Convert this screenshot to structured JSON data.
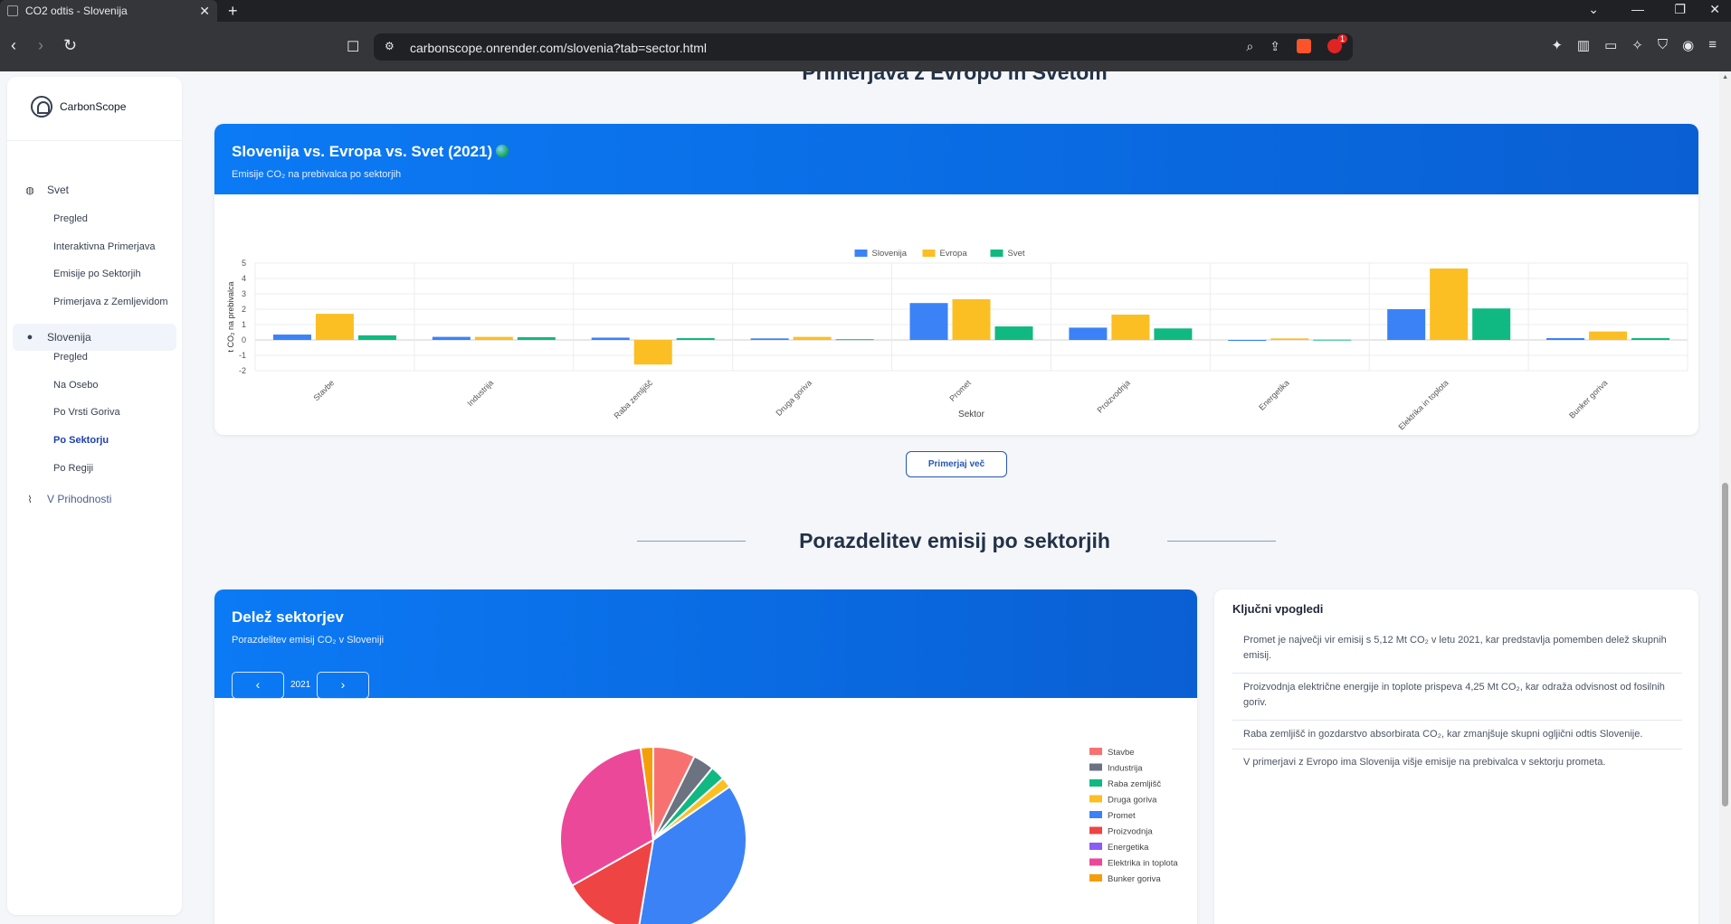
{
  "browser": {
    "tab_title": "CO2 odtis - Slovenija",
    "url": "carbonscope.onrender.com/slovenia?tab=sector.html",
    "notification_count": "1"
  },
  "sidebar": {
    "brand": "CarbonScope",
    "sections": [
      {
        "label": "Svet",
        "icon": "globe-icon",
        "items": [
          "Pregled",
          "Interaktivna Primerjava",
          "Emisije po Sektorjih",
          "Primerjava z Zemljevidom"
        ]
      },
      {
        "label": "Slovenija",
        "icon": "map-pin-icon",
        "items": [
          "Pregled",
          "Na Osebo",
          "Po Vrsti Goriva",
          "Po Sektorju",
          "Po Regiji"
        ]
      },
      {
        "label": "V Prihodnosti",
        "icon": "trend-chart-icon",
        "items": []
      }
    ],
    "current_item": "Po Sektorju"
  },
  "comparison": {
    "heading": "Primerjava z Evropo in Svetom",
    "card_title": "Slovenija vs. Evropa vs. Svet (2021)",
    "card_subtitle": "Emisije CO₂ na prebivalca po sektorjih",
    "button_label": "Primerjaj več"
  },
  "distribution": {
    "heading": "Porazdelitev emisij po sektorjih",
    "card_title": "Delež sektorjev",
    "card_subtitle": "Porazdelitev emisij CO₂ v Sloveniji",
    "year": "2021",
    "prev_icon": "chevron-left-icon",
    "next_icon": "chevron-right-icon"
  },
  "insights": {
    "title": "Ključni vpogledi",
    "items": [
      "Promet je največji vir emisij s 5,12 Mt CO₂ v letu 2021, kar predstavlja pomemben delež skupnih emisij.",
      "Proizvodnja električne energije in toplote prispeva 4,25 Mt CO₂, kar odraža odvisnost od fosilnih goriv.",
      "Raba zemljišč in gozdarstvo absorbirata CO₂, kar zmanjšuje skupni ogljični odtis Slovenije.",
      "V primerjavi z Evropo ima Slovenija višje emisije na prebivalca v sektorju prometa."
    ]
  },
  "colors": {
    "slovenija": "#3b82f6",
    "evropa": "#fbbf24",
    "svet": "#10b981",
    "header_blue": "#0b7af5"
  },
  "chart_data": [
    {
      "type": "bar",
      "title": "",
      "xlabel": "Sektor",
      "ylabel": "t CO₂ na prebivalca",
      "ylim": [
        -2,
        5
      ],
      "yticks": [
        5,
        4,
        3,
        2,
        1,
        0,
        -1,
        -2
      ],
      "grid": true,
      "legend_position": "top",
      "categories": [
        "Stavbe",
        "Industrija",
        "Raba zemljišč",
        "Druga goriva",
        "Promet",
        "Proizvodnja",
        "Energetika",
        "Elektrika in toplota",
        "Bunker goriva"
      ],
      "series": [
        {
          "name": "Slovenija",
          "color": "#3b82f6",
          "values": [
            0.35,
            0.2,
            0.15,
            0.1,
            2.4,
            0.8,
            0.0,
            2.0,
            0.12
          ]
        },
        {
          "name": "Evropa",
          "color": "#fbbf24",
          "values": [
            1.7,
            0.2,
            -1.6,
            0.2,
            2.65,
            1.65,
            0.1,
            4.65,
            0.55
          ]
        },
        {
          "name": "Svet",
          "color": "#10b981",
          "values": [
            0.3,
            0.18,
            0.12,
            0.05,
            0.88,
            0.75,
            0.02,
            2.05,
            0.12
          ]
        }
      ]
    },
    {
      "type": "pie",
      "title": "",
      "legend_position": "right",
      "labels": [
        "Stavbe",
        "Industrija",
        "Raba zemljišč",
        "Druga goriva",
        "Promet",
        "Proizvodnja",
        "Energetika",
        "Elektrika in toplota",
        "Bunker goriva"
      ],
      "colors": [
        "#f87171",
        "#6b7280",
        "#10b981",
        "#fbbf24",
        "#3b82f6",
        "#ef4444",
        "#8b5cf6",
        "#ec4899",
        "#f59e0b"
      ],
      "values": [
        1.0,
        0.5,
        0.35,
        0.25,
        5.12,
        1.95,
        0.0,
        4.25,
        0.3
      ]
    }
  ]
}
